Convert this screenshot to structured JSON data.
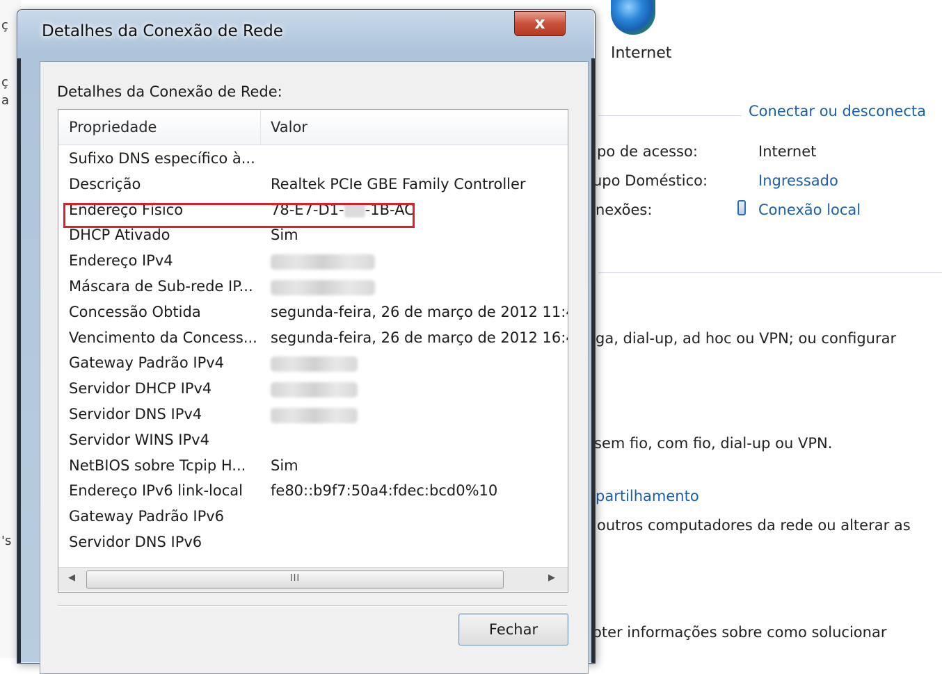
{
  "background": {
    "left_edge_chars": [
      "ç",
      "ç",
      "a",
      "'s"
    ],
    "network_label": "Internet",
    "connect_link": "Conectar ou desconecta",
    "rows": [
      {
        "key": "po de acesso:",
        "value": "Internet",
        "link": false
      },
      {
        "key": "upo Doméstico:",
        "value": "Ingressado",
        "link": true
      },
      {
        "key": "nexões:",
        "value": "Conexão local",
        "link": true
      }
    ],
    "text_lines": [
      "ga, dial-up, ad hoc ou VPN; ou configurar",
      "sem fio, com fio, dial-up ou VPN.",
      "partilhamento",
      "outros computadores da rede ou alterar as",
      "oter informações sobre como solucionar"
    ]
  },
  "dialog": {
    "title": "Detalhes da Conexão de Rede",
    "close_glyph": "x",
    "group_label": "Detalhes da Conexão de Rede:",
    "columns": [
      "Propriedade",
      "Valor"
    ],
    "rows": [
      {
        "prop": "Sufixo DNS específico à...",
        "value": ""
      },
      {
        "prop": "Descrição",
        "value": "Realtek PCIe GBE Family Controller"
      },
      {
        "prop": "Endereço Físico",
        "value_prefix": "78-E7-D1-",
        "value_suffix": "-1B-AC"
      },
      {
        "prop": "DHCP Ativado",
        "value": "Sim"
      },
      {
        "prop": "Endereço IPv4",
        "value": ""
      },
      {
        "prop": "Máscara de Sub-rede IP...",
        "value": ""
      },
      {
        "prop": "Concessão Obtida",
        "value": "segunda-feira, 26 de março de 2012 11:4"
      },
      {
        "prop": "Vencimento da Concess...",
        "value": "segunda-feira, 26 de março de 2012 16:4"
      },
      {
        "prop": "Gateway Padrão IPv4",
        "value": ""
      },
      {
        "prop": "Servidor DHCP IPv4",
        "value": ""
      },
      {
        "prop": "Servidor DNS IPv4",
        "value": ""
      },
      {
        "prop": "Servidor WINS IPv4",
        "value": ""
      },
      {
        "prop": "NetBIOS sobre Tcpip H...",
        "value": "Sim"
      },
      {
        "prop": "Endereço IPv6 link-local",
        "value": "fe80::b9f7:50a4:fdec:bcd0%10"
      },
      {
        "prop": "Gateway Padrão IPv6",
        "value": ""
      },
      {
        "prop": "Servidor DNS IPv6",
        "value": ""
      }
    ],
    "scrollbar": {
      "left_arrow": "◀",
      "right_arrow": "▶",
      "grip": "III"
    },
    "close_button": "Fechar"
  },
  "colors": {
    "highlight": "#d5232b",
    "link": "#1e5ea8"
  }
}
